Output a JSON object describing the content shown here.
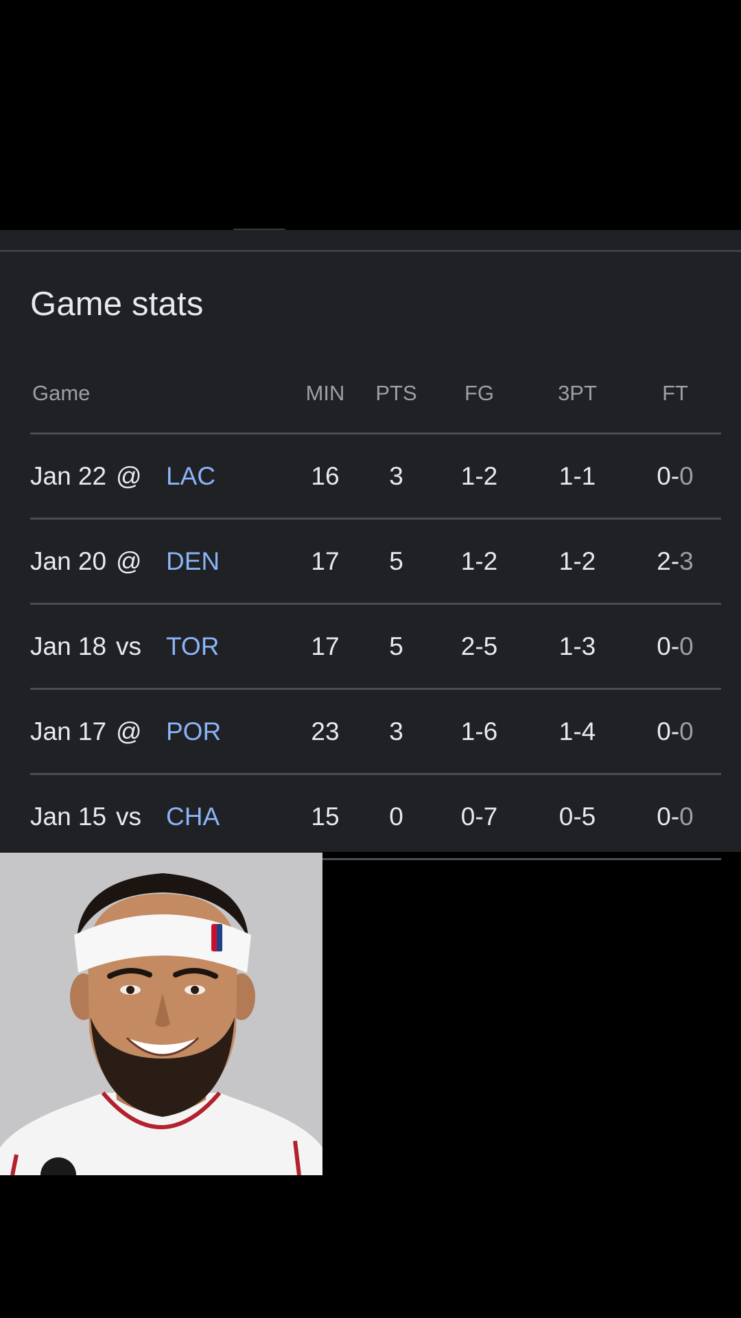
{
  "panel": {
    "title": "Game stats"
  },
  "table": {
    "headers": {
      "game": "Game",
      "min": "MIN",
      "pts": "PTS",
      "fg": "FG",
      "three_pt": "3PT",
      "ft": "FT"
    },
    "rows": [
      {
        "date": "Jan 22",
        "location": "@",
        "opponent": "LAC",
        "min": "16",
        "pts": "3",
        "fg": "1-2",
        "three_pt": "1-1",
        "ft_made": "0",
        "ft_sep": "-",
        "ft_att": "0"
      },
      {
        "date": "Jan 20",
        "location": "@",
        "opponent": "DEN",
        "min": "17",
        "pts": "5",
        "fg": "1-2",
        "three_pt": "1-2",
        "ft_made": "2",
        "ft_sep": "-",
        "ft_att": "3"
      },
      {
        "date": "Jan 18",
        "location": "vs",
        "opponent": "TOR",
        "min": "17",
        "pts": "5",
        "fg": "2-5",
        "three_pt": "1-3",
        "ft_made": "0",
        "ft_sep": "-",
        "ft_att": "0"
      },
      {
        "date": "Jan 17",
        "location": "@",
        "opponent": "POR",
        "min": "23",
        "pts": "3",
        "fg": "1-6",
        "three_pt": "1-4",
        "ft_made": "0",
        "ft_sep": "-",
        "ft_att": "0"
      },
      {
        "date": "Jan 15",
        "location": "vs",
        "opponent": "CHA",
        "min": "15",
        "pts": "0",
        "fg": "0-7",
        "three_pt": "0-5",
        "ft_made": "0",
        "ft_sep": "-",
        "ft_att": "0"
      }
    ]
  },
  "photo": {
    "icon": "player-headshot"
  },
  "colors": {
    "background": "#000000",
    "card": "#202124",
    "text_primary": "#e8eaed",
    "text_secondary": "#9aa0a6",
    "link": "#8ab4f8",
    "divider": "#4a4d51"
  }
}
